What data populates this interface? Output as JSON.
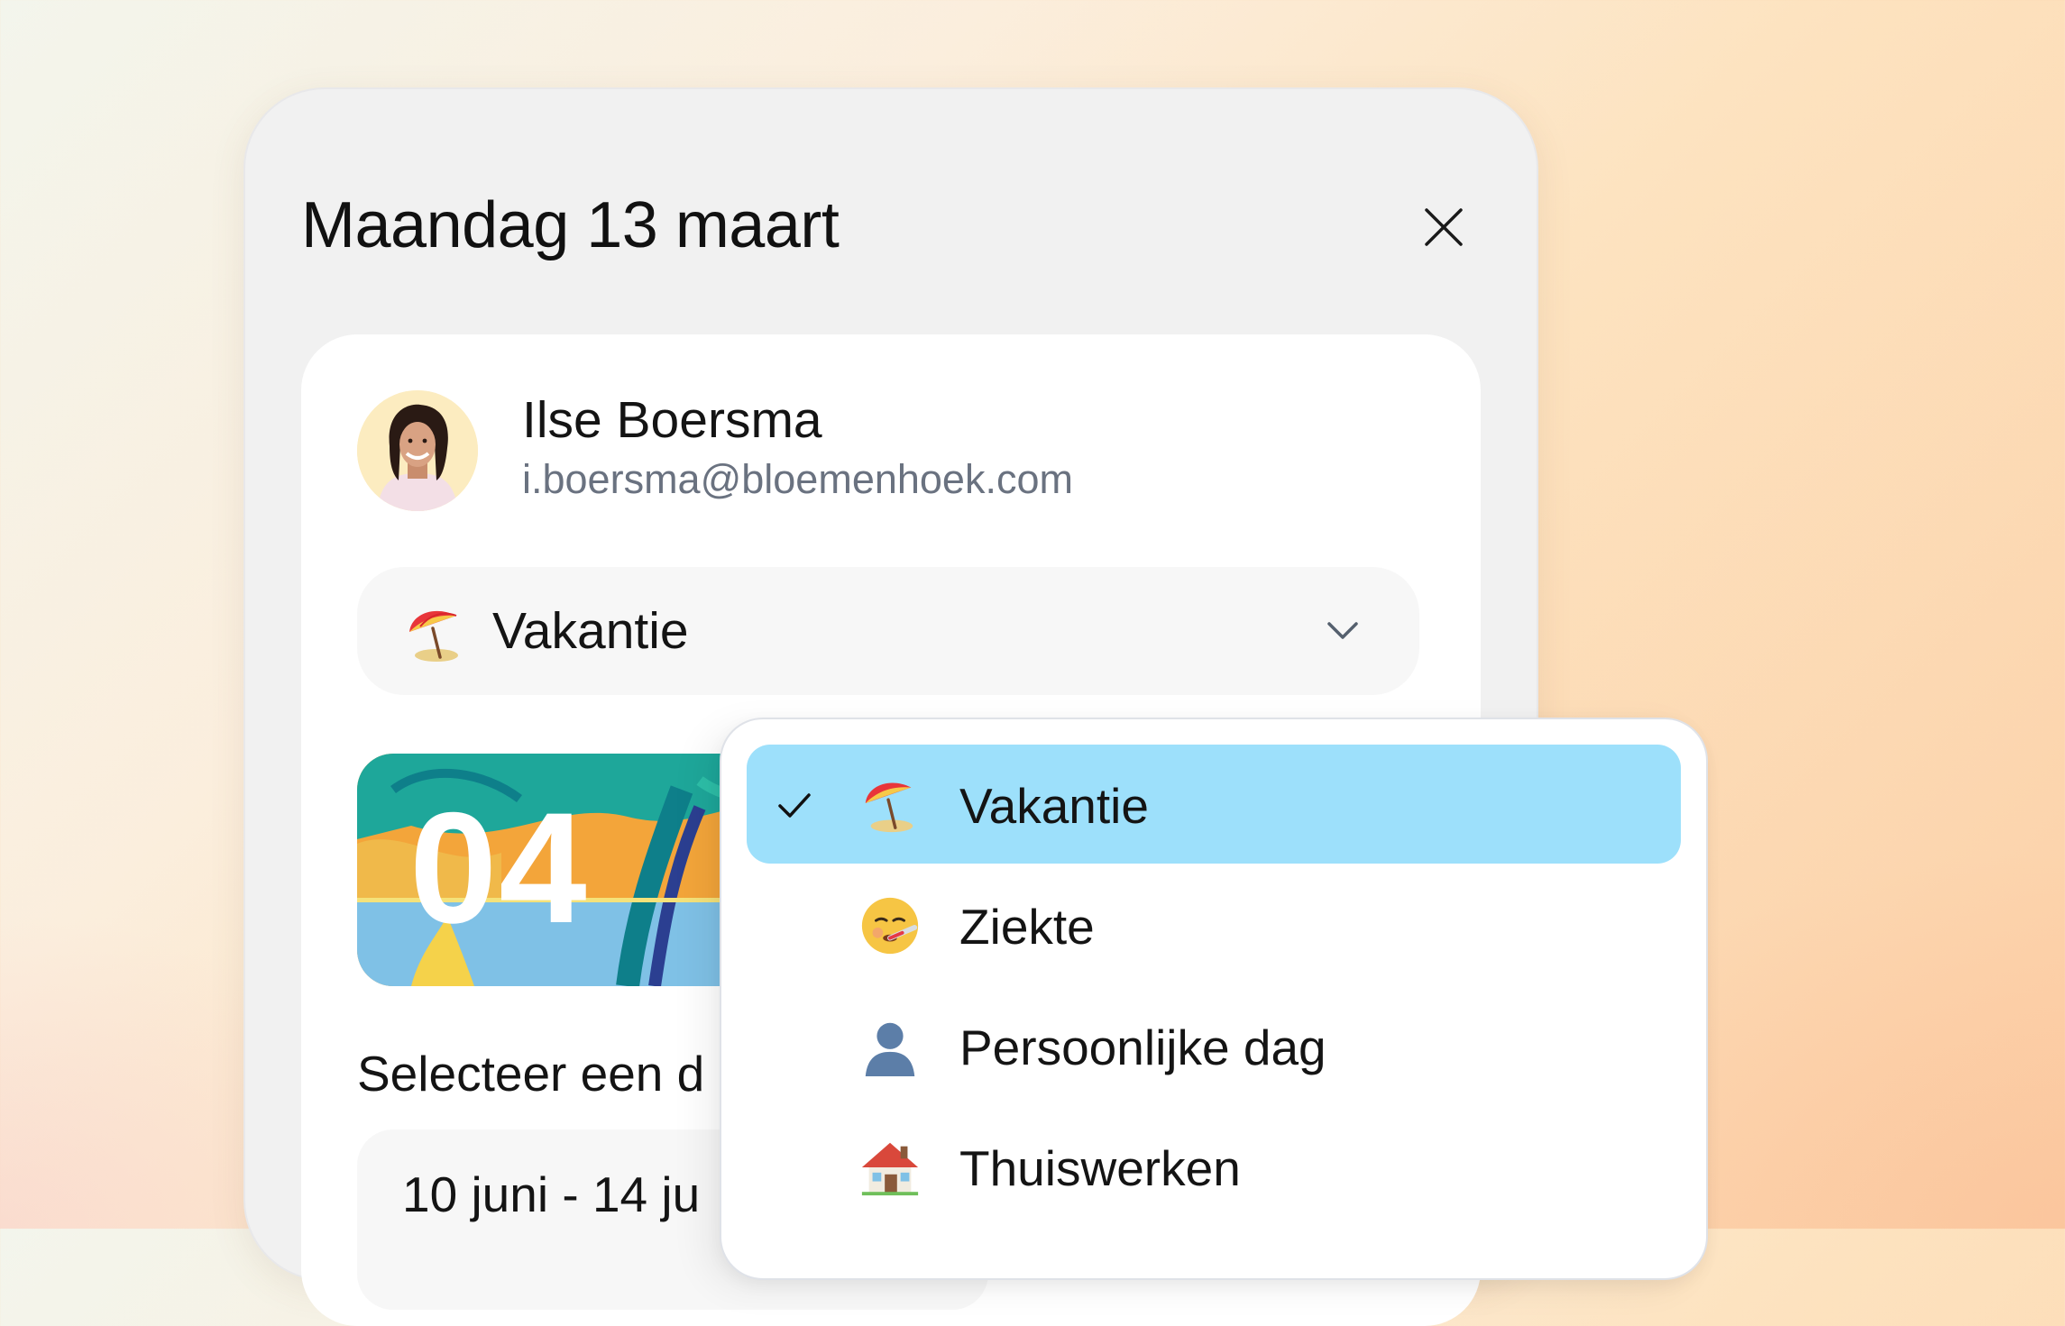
{
  "modal": {
    "title": "Maandag 13 maart",
    "close_icon": "close-icon"
  },
  "user": {
    "name": "Ilse Boersma",
    "email": "i.boersma@bloemenhoek.com"
  },
  "leave_type": {
    "selected_label": "Vakantie",
    "icon": "umbrella-on-ground-icon",
    "chevron": "chevron-down-icon"
  },
  "promo": {
    "number": "04"
  },
  "date_section": {
    "heading": "Selecteer een d",
    "value": "10 juni - 14 ju"
  },
  "dropdown": {
    "items": [
      {
        "label": "Vakantie",
        "icon": "umbrella-icon",
        "selected": true
      },
      {
        "label": "Ziekte",
        "icon": "face-with-thermometer-icon",
        "selected": false
      },
      {
        "label": "Persoonlijke dag",
        "icon": "person-silhouette-icon",
        "selected": false
      },
      {
        "label": "Thuiswerken",
        "icon": "house-icon",
        "selected": false
      }
    ]
  },
  "colors": {
    "selected_item": "#9de0fb",
    "modal_bg": "#f1f1f1",
    "card_bg": "#ffffff",
    "email_text": "#6a7280"
  }
}
